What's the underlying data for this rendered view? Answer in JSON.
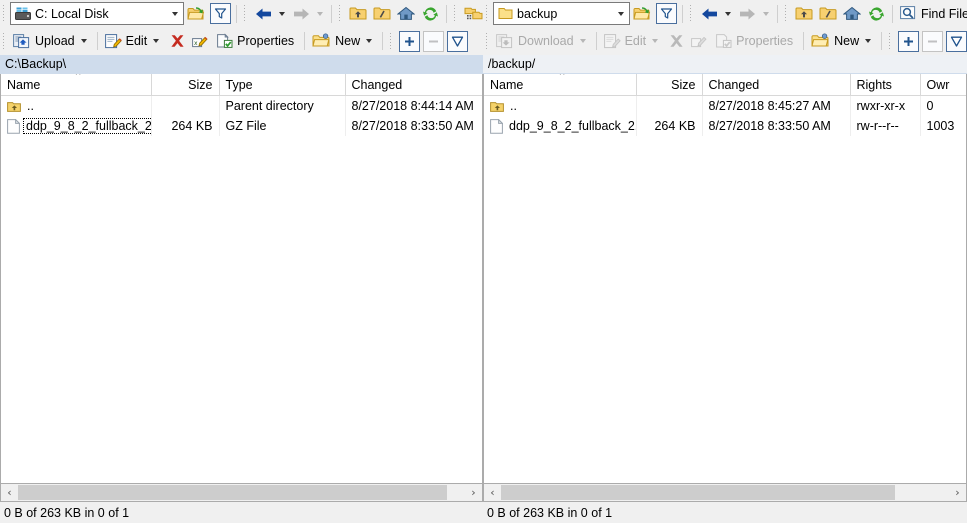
{
  "left_panel": {
    "address": {
      "value": "C: Local Disk",
      "icon": "local-disk-icon"
    },
    "path": "C:\\Backup\\",
    "toolbar_row1": [
      {
        "name": "open-directory-icon",
        "label": "",
        "type": "icon",
        "enabled": true
      },
      {
        "name": "filter-icon",
        "label": "",
        "type": "icon-framed",
        "enabled": true
      },
      {
        "name": "back-icon",
        "label": "",
        "type": "icon-caret",
        "enabled": true
      },
      {
        "name": "forward-icon",
        "label": "",
        "type": "icon-caret",
        "enabled": false
      },
      {
        "name": "parent-directory-icon",
        "label": "",
        "type": "icon",
        "enabled": true
      },
      {
        "name": "root-directory-icon",
        "label": "",
        "type": "icon",
        "enabled": true
      },
      {
        "name": "home-directory-icon",
        "label": "",
        "type": "icon",
        "enabled": true
      },
      {
        "name": "refresh-icon",
        "label": "",
        "type": "icon",
        "enabled": true
      },
      {
        "name": "select-files-icon",
        "label": "",
        "type": "icon",
        "enabled": true
      }
    ],
    "toolbar_row2": [
      {
        "name": "upload-button",
        "label": "Upload",
        "enabled": true
      },
      {
        "name": "edit-button",
        "label": "Edit",
        "enabled": true
      },
      {
        "name": "delete-button",
        "label": "",
        "enabled": true
      },
      {
        "name": "rename-button",
        "label": "",
        "enabled": true
      },
      {
        "name": "properties-button",
        "label": "Properties",
        "enabled": true
      },
      {
        "name": "new-button",
        "label": "New",
        "enabled": true
      },
      {
        "name": "select-add-button",
        "label": "",
        "enabled": true
      },
      {
        "name": "select-remove-button",
        "label": "",
        "enabled": false
      },
      {
        "name": "select-invert-button",
        "label": "",
        "enabled": true
      }
    ],
    "columns": [
      {
        "key": "name",
        "label": "Name",
        "align": "left",
        "sorted": true
      },
      {
        "key": "size",
        "label": "Size",
        "align": "right",
        "sorted": false
      },
      {
        "key": "type",
        "label": "Type",
        "align": "left",
        "sorted": false
      },
      {
        "key": "changed",
        "label": "Changed",
        "align": "left",
        "sorted": false
      }
    ],
    "rows": [
      {
        "icon": "parent-folder-icon",
        "name": "..",
        "size": "",
        "type": "Parent directory",
        "changed": "8/27/2018  8:44:14 AM",
        "focused": false
      },
      {
        "icon": "file-icon",
        "name": "ddp_9_8_2_fullback_2...",
        "size": "264 KB",
        "type": "GZ File",
        "changed": "8/27/2018  8:33:50 AM",
        "focused": true
      }
    ],
    "scroll": {
      "left_arrow": "‹",
      "right_arrow": "›",
      "thumb_percent": 96
    },
    "status": "0 B of 263 KB in 0 of 1"
  },
  "right_panel": {
    "address": {
      "value": "backup",
      "icon": "remote-folder-icon"
    },
    "path": "/backup/",
    "toolbar_row1": [
      {
        "name": "open-directory-icon",
        "label": "",
        "type": "icon",
        "enabled": true
      },
      {
        "name": "filter-icon",
        "label": "",
        "type": "icon-framed",
        "enabled": true
      },
      {
        "name": "back-icon",
        "label": "",
        "type": "icon-caret",
        "enabled": true
      },
      {
        "name": "forward-icon",
        "label": "",
        "type": "icon-caret",
        "enabled": false
      },
      {
        "name": "parent-directory-icon",
        "label": "",
        "type": "icon",
        "enabled": true
      },
      {
        "name": "root-directory-icon",
        "label": "",
        "type": "icon",
        "enabled": true
      },
      {
        "name": "home-directory-icon",
        "label": "",
        "type": "icon",
        "enabled": true
      },
      {
        "name": "refresh-icon",
        "label": "",
        "type": "icon",
        "enabled": true
      },
      {
        "name": "find-files-button",
        "label": "Find Files",
        "type": "labelled",
        "enabled": true
      },
      {
        "name": "select-files-icon",
        "label": "",
        "type": "icon",
        "enabled": true
      }
    ],
    "toolbar_row2": [
      {
        "name": "download-button",
        "label": "Download",
        "enabled": false
      },
      {
        "name": "edit-button",
        "label": "Edit",
        "enabled": false
      },
      {
        "name": "delete-button",
        "label": "",
        "enabled": false
      },
      {
        "name": "rename-button",
        "label": "",
        "enabled": false
      },
      {
        "name": "properties-button",
        "label": "Properties",
        "enabled": false
      },
      {
        "name": "new-button",
        "label": "New",
        "enabled": true
      },
      {
        "name": "select-add-button",
        "label": "",
        "enabled": true
      },
      {
        "name": "select-remove-button",
        "label": "",
        "enabled": false
      },
      {
        "name": "select-invert-button",
        "label": "",
        "enabled": true
      }
    ],
    "columns": [
      {
        "key": "name",
        "label": "Name",
        "align": "left",
        "sorted": true
      },
      {
        "key": "size",
        "label": "Size",
        "align": "right",
        "sorted": false
      },
      {
        "key": "changed",
        "label": "Changed",
        "align": "left",
        "sorted": false
      },
      {
        "key": "rights",
        "label": "Rights",
        "align": "left",
        "sorted": false
      },
      {
        "key": "owner",
        "label": "Owr",
        "align": "left",
        "sorted": false
      }
    ],
    "rows": [
      {
        "icon": "parent-folder-icon",
        "name": "..",
        "size": "",
        "changed": "8/27/2018 8:45:27 AM",
        "rights": "rwxr-xr-x",
        "owner": "0",
        "focused": false
      },
      {
        "icon": "file-icon",
        "name": "ddp_9_8_2_fullback_2...",
        "size": "264 KB",
        "changed": "8/27/2018 8:33:50 AM",
        "rights": "rw-r--r--",
        "owner": "1003",
        "focused": false
      }
    ],
    "scroll": {
      "left_arrow": "‹",
      "right_arrow": "›",
      "thumb_percent": 88
    },
    "status": "0 B of 263 KB in 0 of 1"
  },
  "colors": {
    "active_path_bg": "#cfdcec",
    "inactive_path_bg": "#eef1f5",
    "toolbar_bg": "#f0f0f0",
    "folder_yellow": "#f5c33b",
    "accent_blue": "#1f5bbf",
    "delete_red": "#cc2222",
    "refresh_green": "#33aa33"
  }
}
